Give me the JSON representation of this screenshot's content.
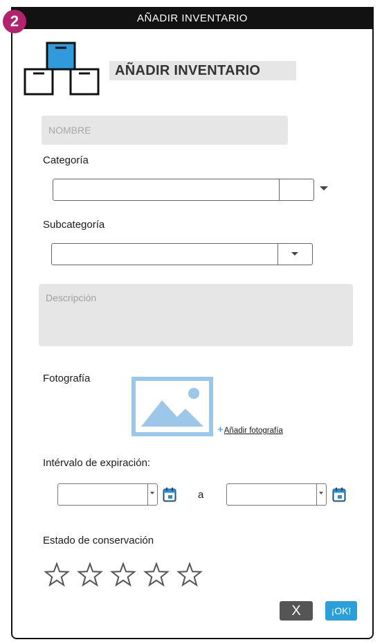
{
  "window": {
    "title": "AÑADIR INVENTARIO",
    "step": "2"
  },
  "header": {
    "title": "AÑADIR INVENTARIO",
    "icon": "boxes-icon"
  },
  "form": {
    "name_placeholder": "NOMBRE",
    "category_label": "Categoría",
    "category_value": "",
    "subcategory_label": "Subcategoría",
    "subcategory_value": "",
    "description_placeholder": "Descripción",
    "photo_label": "Fotografía",
    "photo_icon": "image-placeholder-icon",
    "add_photo_plus": "+",
    "add_photo_label": "Añadir fotografía",
    "expiration_label": "Intérvalo de expiración:",
    "expiration_from": "",
    "expiration_to": "",
    "range_separator": "a",
    "condition_label": "Estado de conservación",
    "condition_rating": 0,
    "condition_max": 5
  },
  "actions": {
    "cancel_label": "X",
    "ok_label": "¡OK!"
  },
  "colors": {
    "accent": "#2a9fd8",
    "badge": "#b3226f",
    "titlebar": "#121212",
    "field_bg": "#e6e6e6",
    "photo": "#9cc7e8"
  }
}
